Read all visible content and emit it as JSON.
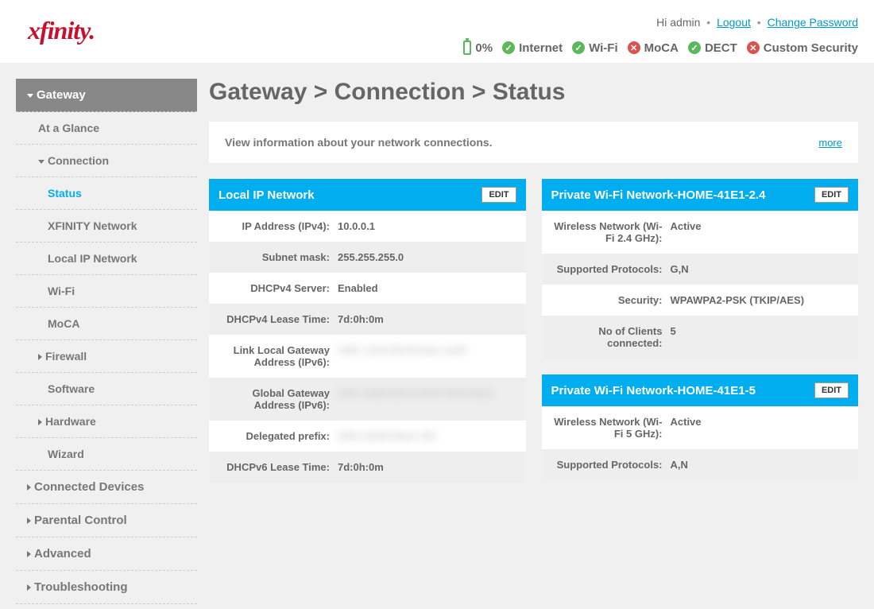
{
  "header": {
    "logo": "xfinity",
    "greeting": "Hi admin",
    "logout": "Logout",
    "change_password": "Change Password",
    "battery": "0%",
    "status": [
      {
        "label": "Internet",
        "ok": true
      },
      {
        "label": "Wi-Fi",
        "ok": true
      },
      {
        "label": "MoCA",
        "ok": false
      },
      {
        "label": "DECT",
        "ok": true
      },
      {
        "label": "Custom Security",
        "ok": false
      }
    ]
  },
  "sidebar": {
    "items": [
      {
        "label": "Gateway",
        "caret": "down",
        "selected": true,
        "level": 0
      },
      {
        "label": "At a Glance",
        "level": 1
      },
      {
        "label": "Connection",
        "caret": "down",
        "level": 1
      },
      {
        "label": "Status",
        "active": true,
        "level": 2
      },
      {
        "label": "XFINITY Network",
        "level": 2
      },
      {
        "label": "Local IP Network",
        "level": 2
      },
      {
        "label": "Wi-Fi",
        "level": 2
      },
      {
        "label": "MoCA",
        "level": 2
      },
      {
        "label": "Firewall",
        "caret": "right",
        "level": 1
      },
      {
        "label": "Software",
        "level": 2
      },
      {
        "label": "Hardware",
        "caret": "right",
        "level": 1
      },
      {
        "label": "Wizard",
        "level": 2
      },
      {
        "label": "Connected Devices",
        "caret": "right",
        "level": 0
      },
      {
        "label": "Parental Control",
        "caret": "right",
        "level": 0
      },
      {
        "label": "Advanced",
        "caret": "right",
        "level": 0
      },
      {
        "label": "Troubleshooting",
        "caret": "right",
        "level": 0
      }
    ]
  },
  "page": {
    "title": "Gateway > Connection > Status",
    "info": "View information about your network connections.",
    "more": "more",
    "edit": "EDIT"
  },
  "panels": {
    "local_ip": {
      "title": "Local IP Network",
      "rows": [
        {
          "label": "IP Address (IPv4):",
          "value": "10.0.0.1"
        },
        {
          "label": "Subnet mask:",
          "value": "255.255.255.0"
        },
        {
          "label": "DHCPv4 Server:",
          "value": "Enabled"
        },
        {
          "label": "DHCPv4 Lease Time:",
          "value": "7d:0h:0m"
        },
        {
          "label": "Link Local Gateway Address (IPv6):",
          "value": "fe80::1234:5678:9abc:def0",
          "blur": true
        },
        {
          "label": "Global Gateway Address (IPv6):",
          "value": "2001:0db8:85a3:0000:0000:8a2e",
          "blur": true
        },
        {
          "label": "Delegated prefix:",
          "value": "2001:0db8:85a3::/64",
          "blur": true
        },
        {
          "label": "DHCPv6 Lease Time:",
          "value": "7d:0h:0m"
        }
      ]
    },
    "wifi24": {
      "title": "Private Wi-Fi Network-HOME-41E1-2.4",
      "rows": [
        {
          "label": "Wireless Network (Wi-Fi 2.4 GHz):",
          "value": "Active"
        },
        {
          "label": "Supported Protocols:",
          "value": "G,N"
        },
        {
          "label": "Security:",
          "value": "WPAWPA2-PSK (TKIP/AES)"
        },
        {
          "label": "No of Clients connected:",
          "value": "5"
        }
      ]
    },
    "wifi5": {
      "title": "Private Wi-Fi Network-HOME-41E1-5",
      "rows": [
        {
          "label": "Wireless Network (Wi-Fi 5 GHz):",
          "value": "Active"
        },
        {
          "label": "Supported Protocols:",
          "value": "A,N"
        }
      ]
    }
  }
}
